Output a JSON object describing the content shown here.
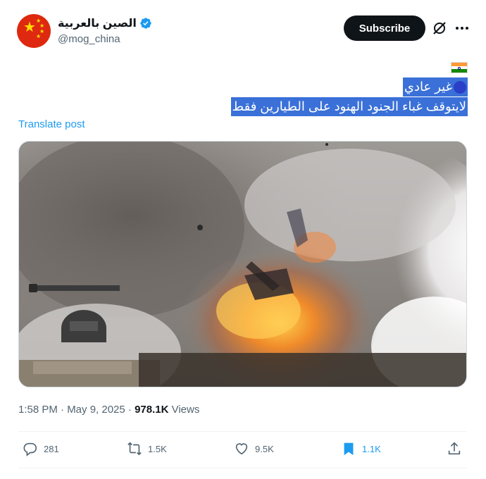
{
  "account": {
    "display_name": "الصين بالعربية",
    "handle": "@mog_china"
  },
  "header": {
    "subscribe_label": "Subscribe"
  },
  "post": {
    "line1": "غير عادي",
    "line2": "لايتوقف غباء الجنود الهنود على الطيارين فقط",
    "translate_label": "Translate post"
  },
  "meta": {
    "timestamp": "1:58 PM · May 9, 2025 · ",
    "views_count": "978.1K",
    "views_label": " Views"
  },
  "actions": {
    "replies": "281",
    "reposts": "1.5K",
    "likes": "9.5K",
    "bookmarks": "1.1K"
  },
  "colors": {
    "accent": "#1d9bf0",
    "highlight": "#3a70d8",
    "text_primary": "#0f1419",
    "text_secondary": "#536471"
  },
  "icons": [
    "china-flag-avatar",
    "verified-badge-icon",
    "grok-icon",
    "more-icon",
    "india-flag-icon",
    "blue-circle-icon",
    "reply-icon",
    "repost-icon",
    "like-icon",
    "bookmark-icon",
    "share-icon"
  ]
}
